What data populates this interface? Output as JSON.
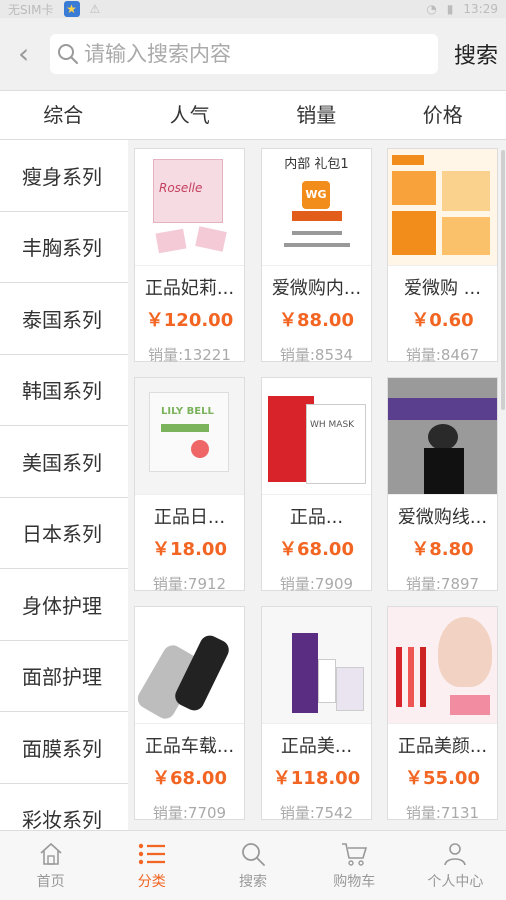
{
  "status_bar": {
    "carrier": "无SIM卡",
    "time": "13:29"
  },
  "header": {
    "back_icon": "chevron-left-icon",
    "search_placeholder": "请输入搜索内容",
    "search_button": "搜索"
  },
  "sort_tabs": [
    "综合",
    "人气",
    "销量",
    "价格"
  ],
  "sidebar": [
    "瘦身系列",
    "丰胸系列",
    "泰国系列",
    "韩国系列",
    "美国系列",
    "日本系列",
    "身体护理",
    "面部护理",
    "面膜系列",
    "彩妆系列"
  ],
  "products": [
    {
      "name": "正品妃莉...",
      "price": "￥120.00",
      "sales": "销量:13221",
      "img_text": "Roselle"
    },
    {
      "name": "爱微购内...",
      "price": "￥88.00",
      "sales": "销量:8534",
      "img_text": "内部 礼包1"
    },
    {
      "name": "爱微购 ...",
      "price": "￥0.60",
      "sales": "销量:8467",
      "img_text": ""
    },
    {
      "name": "正品日...",
      "price": "￥18.00",
      "sales": "销量:7912",
      "img_text": "LILY BELL"
    },
    {
      "name": "正品...",
      "price": "￥68.00",
      "sales": "销量:7909",
      "img_text": "WH MASK"
    },
    {
      "name": "爱微购线...",
      "price": "￥8.80",
      "sales": "销量:7897",
      "img_text": ""
    },
    {
      "name": "正品车载...",
      "price": "￥68.00",
      "sales": "销量:7709",
      "img_text": ""
    },
    {
      "name": "正品美...",
      "price": "￥118.00",
      "sales": "销量:7542",
      "img_text": ""
    },
    {
      "name": "正品美颜...",
      "price": "￥55.00",
      "sales": "销量:7131",
      "img_text": ""
    }
  ],
  "bottom_nav": [
    {
      "label": "首页",
      "icon": "home-icon"
    },
    {
      "label": "分类",
      "icon": "list-icon",
      "active": true
    },
    {
      "label": "搜索",
      "icon": "search-icon"
    },
    {
      "label": "购物车",
      "icon": "cart-icon"
    },
    {
      "label": "个人中心",
      "icon": "user-icon"
    }
  ],
  "colors": {
    "accent": "#f26522",
    "price": "#f26522"
  }
}
